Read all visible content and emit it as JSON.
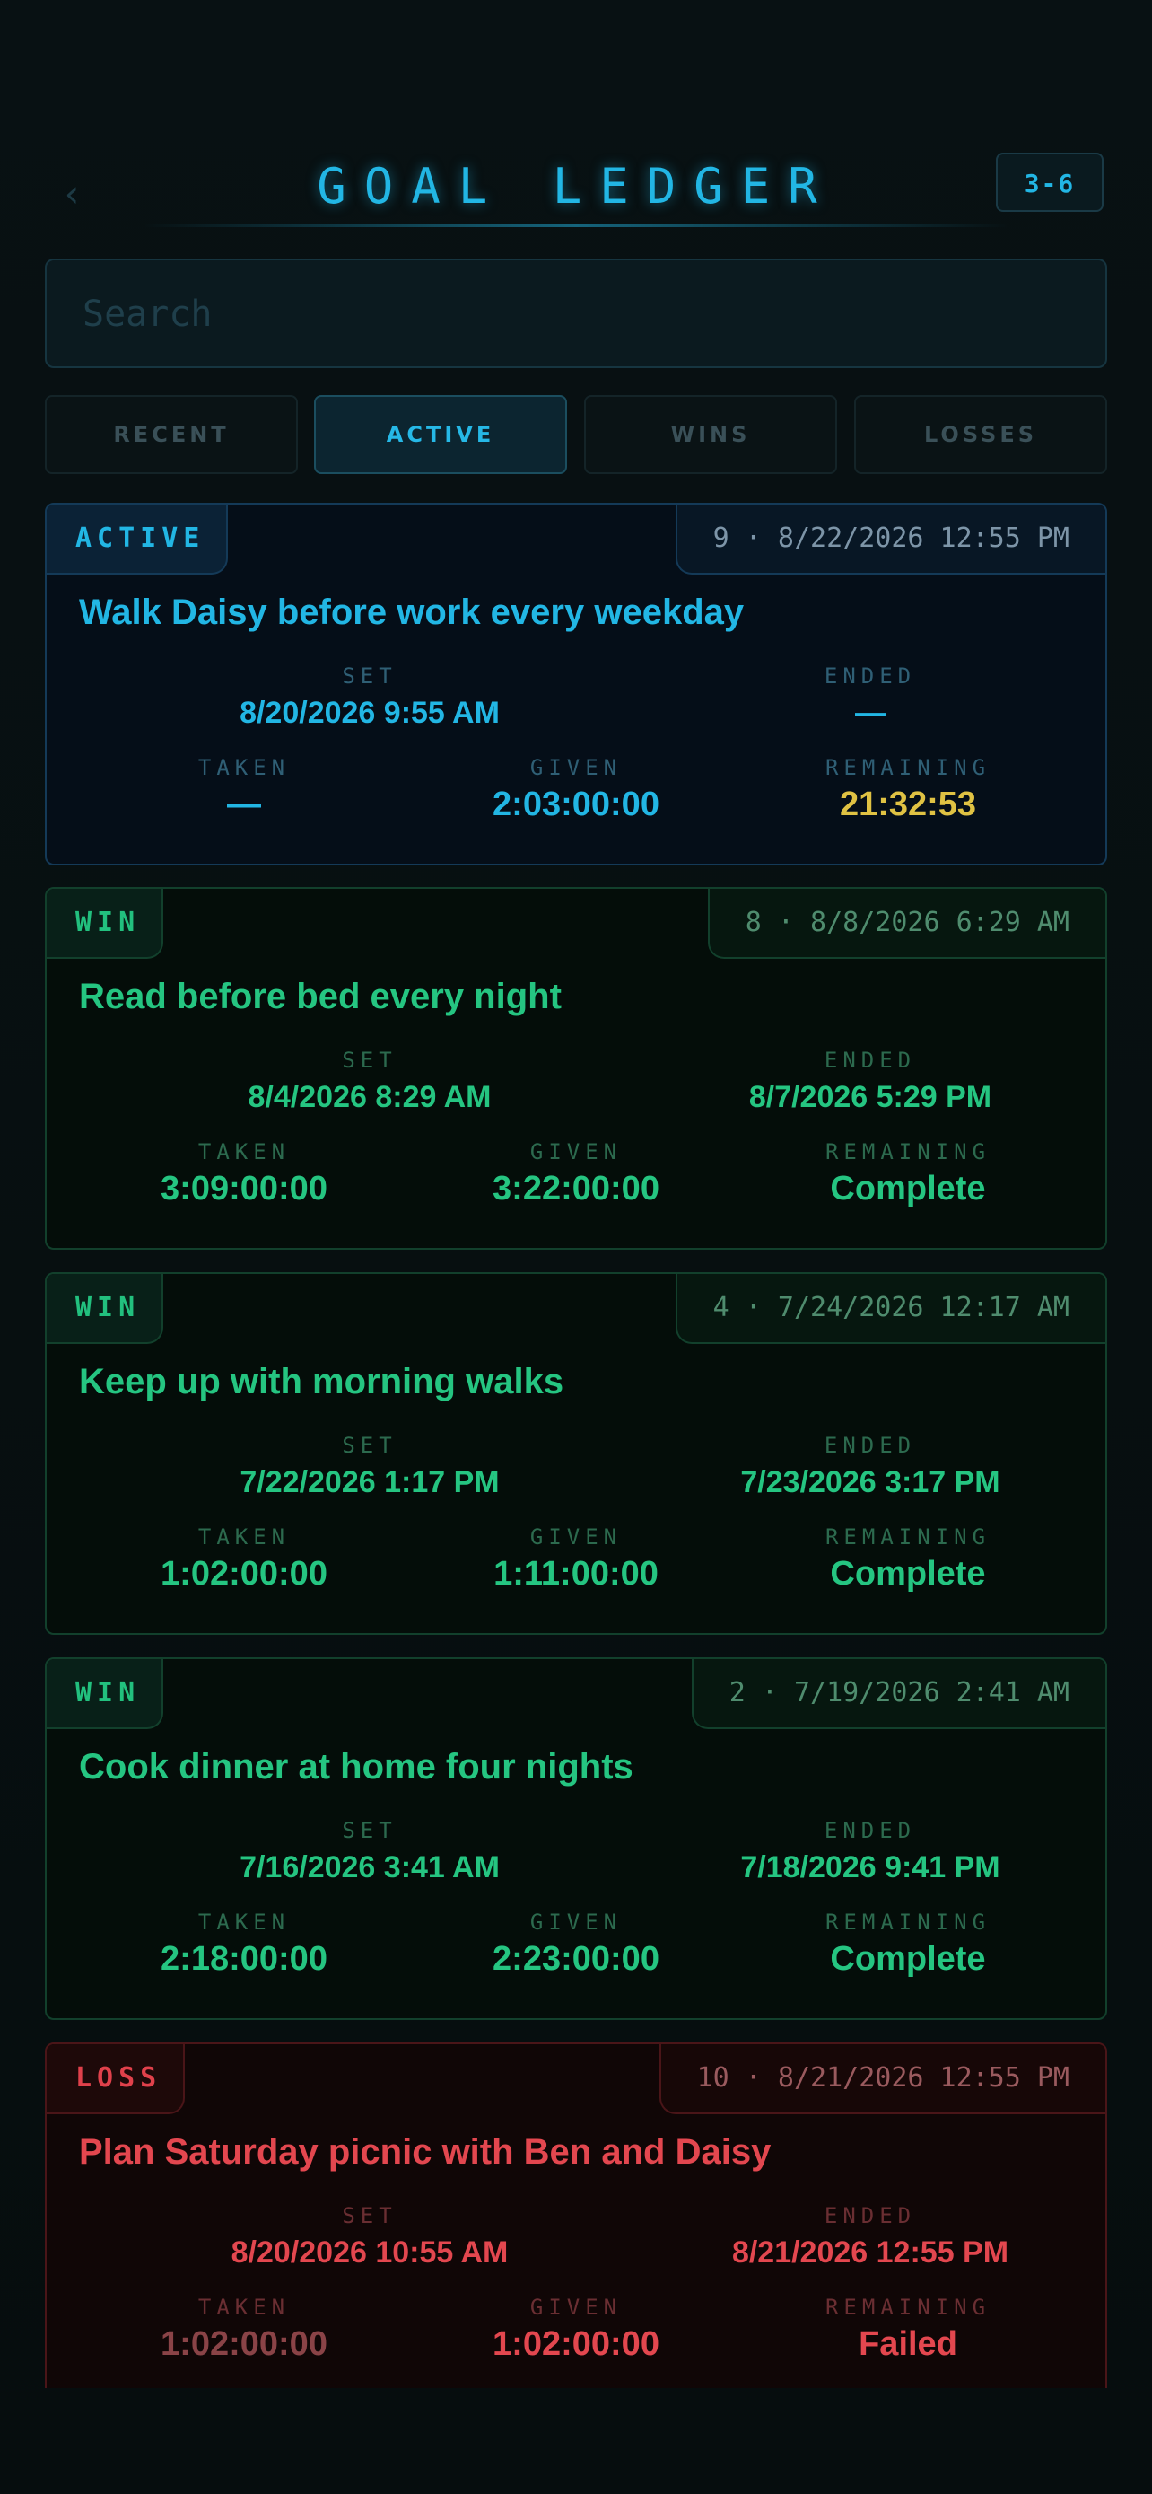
{
  "header": {
    "back_glyph": "‹",
    "title": "GOAL LEDGER",
    "badge": "3-6"
  },
  "search": {
    "placeholder": "Search",
    "value": ""
  },
  "tabs": [
    {
      "label": "RECENT",
      "active": false
    },
    {
      "label": "ACTIVE",
      "active": true
    },
    {
      "label": "WINS",
      "active": false
    },
    {
      "label": "LOSSES",
      "active": false
    }
  ],
  "field_labels": {
    "set": "SET",
    "ended": "ENDED",
    "taken": "TAKEN",
    "given": "GIVEN",
    "remaining": "REMAINING"
  },
  "goals": [
    {
      "status": "ACTIVE",
      "meta": "9 · 8/22/2026 12:55 PM",
      "title": "Walk Daisy before work every weekday",
      "set": "8/20/2026 9:55 AM",
      "ended": "—",
      "taken": "—",
      "given": "2:03:00:00",
      "remaining": "21:32:53"
    },
    {
      "status": "WIN",
      "meta": "8 · 8/8/2026 6:29 AM",
      "title": "Read before bed every night",
      "set": "8/4/2026 8:29 AM",
      "ended": "8/7/2026 5:29 PM",
      "taken": "3:09:00:00",
      "given": "3:22:00:00",
      "remaining": "Complete"
    },
    {
      "status": "WIN",
      "meta": "4 · 7/24/2026 12:17 AM",
      "title": "Keep up with morning walks",
      "set": "7/22/2026 1:17 PM",
      "ended": "7/23/2026 3:17 PM",
      "taken": "1:02:00:00",
      "given": "1:11:00:00",
      "remaining": "Complete"
    },
    {
      "status": "WIN",
      "meta": "2 · 7/19/2026 2:41 AM",
      "title": "Cook dinner at home four nights",
      "set": "7/16/2026 3:41 AM",
      "ended": "7/18/2026 9:41 PM",
      "taken": "2:18:00:00",
      "given": "2:23:00:00",
      "remaining": "Complete"
    },
    {
      "status": "LOSS",
      "meta": "10 · 8/21/2026 12:55 PM",
      "title": "Plan Saturday picnic with Ben and Daisy",
      "set": "8/20/2026 10:55 AM",
      "ended": "8/21/2026 12:55 PM",
      "taken": "1:02:00:00",
      "given": "1:02:00:00",
      "remaining": "Failed"
    }
  ],
  "colors": {
    "active_accent": "#22b6e4",
    "win_accent": "#25c581",
    "loss_accent": "#e3474f",
    "remaining_warn": "#e0c243"
  }
}
